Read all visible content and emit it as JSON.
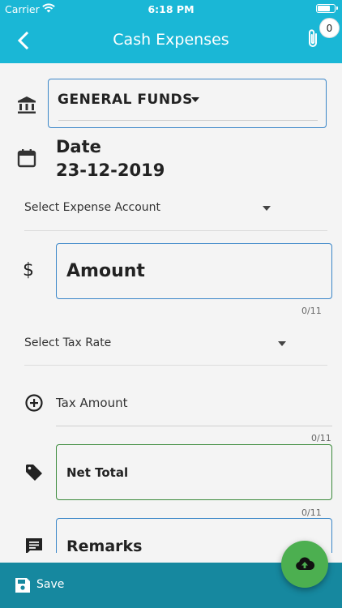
{
  "status_bar": {
    "carrier": "Carrier",
    "time": "6:18 PM"
  },
  "header": {
    "title": "Cash Expenses",
    "attachment_count": "0"
  },
  "form": {
    "fund": "GENERAL FUNDS",
    "date_label": "Date",
    "date_value": "23-12-2019",
    "expense_account_placeholder": "Select Expense Account",
    "amount_placeholder": "Amount",
    "amount_counter": "0/11",
    "tax_rate_placeholder": "Select Tax Rate",
    "tax_amount_placeholder": "Tax Amount",
    "tax_amount_counter": "0/11",
    "net_total_placeholder": "Net Total",
    "net_total_counter": "0/11",
    "remarks_placeholder": "Remarks"
  },
  "bottom_bar": {
    "save_label": "Save"
  },
  "colors": {
    "header": "#1ab7d6",
    "bottom_bar": "#16889f",
    "fab": "#4caf50",
    "focus_blue": "#3a86c8",
    "green_border": "#3b8a3b"
  },
  "icons": [
    "back-arrow-icon",
    "paperclip-icon",
    "bank-icon",
    "calendar-icon",
    "dollar-icon",
    "add-circle-icon",
    "tag-icon",
    "comment-icon",
    "save-icon",
    "cloud-upload-icon"
  ]
}
